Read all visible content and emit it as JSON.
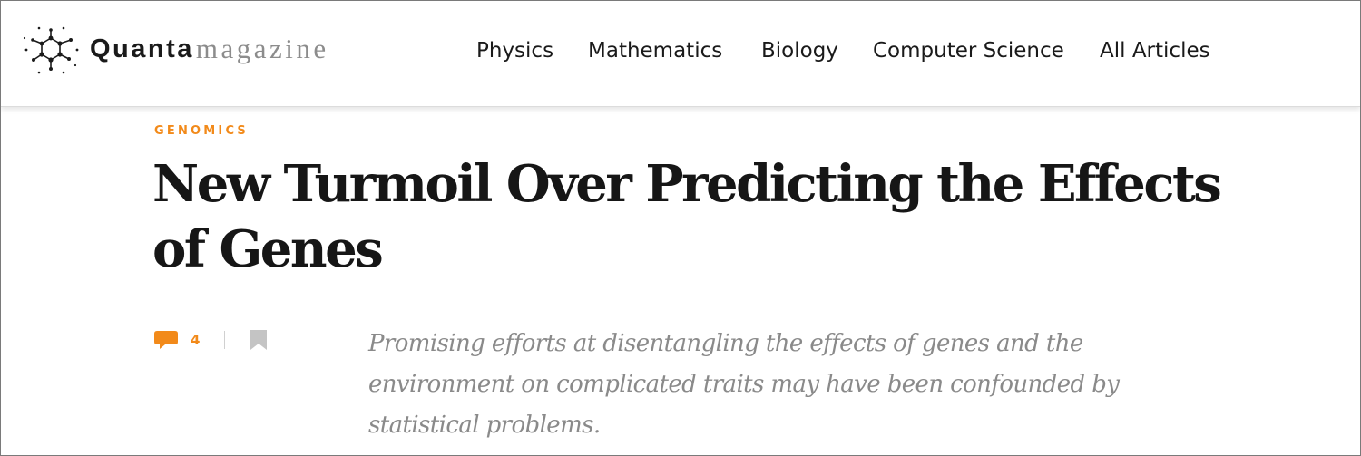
{
  "brand": {
    "name_part1": "Quanta",
    "name_part2": "magazine",
    "logo_icon": "molecule-network-icon"
  },
  "nav": {
    "items": [
      {
        "label": "Physics"
      },
      {
        "label": "Mathematics"
      },
      {
        "label": "Biology"
      },
      {
        "label": "Computer Science"
      },
      {
        "label": "All Articles"
      }
    ]
  },
  "article": {
    "kicker": "GENOMICS",
    "title": "New Turmoil Over Predicting the Effects of Genes",
    "comment_count": "4",
    "comment_icon": "speech-bubble-icon",
    "bookmark_icon": "bookmark-icon",
    "dek": "Promising efforts at disentangling the effects of genes and the environment on complicated traits may have been confounded by statistical problems."
  },
  "colors": {
    "accent": "#f28a1a",
    "text": "#1a1a1a",
    "muted": "#8a8a8a",
    "bookmark": "#c4c4c4"
  }
}
